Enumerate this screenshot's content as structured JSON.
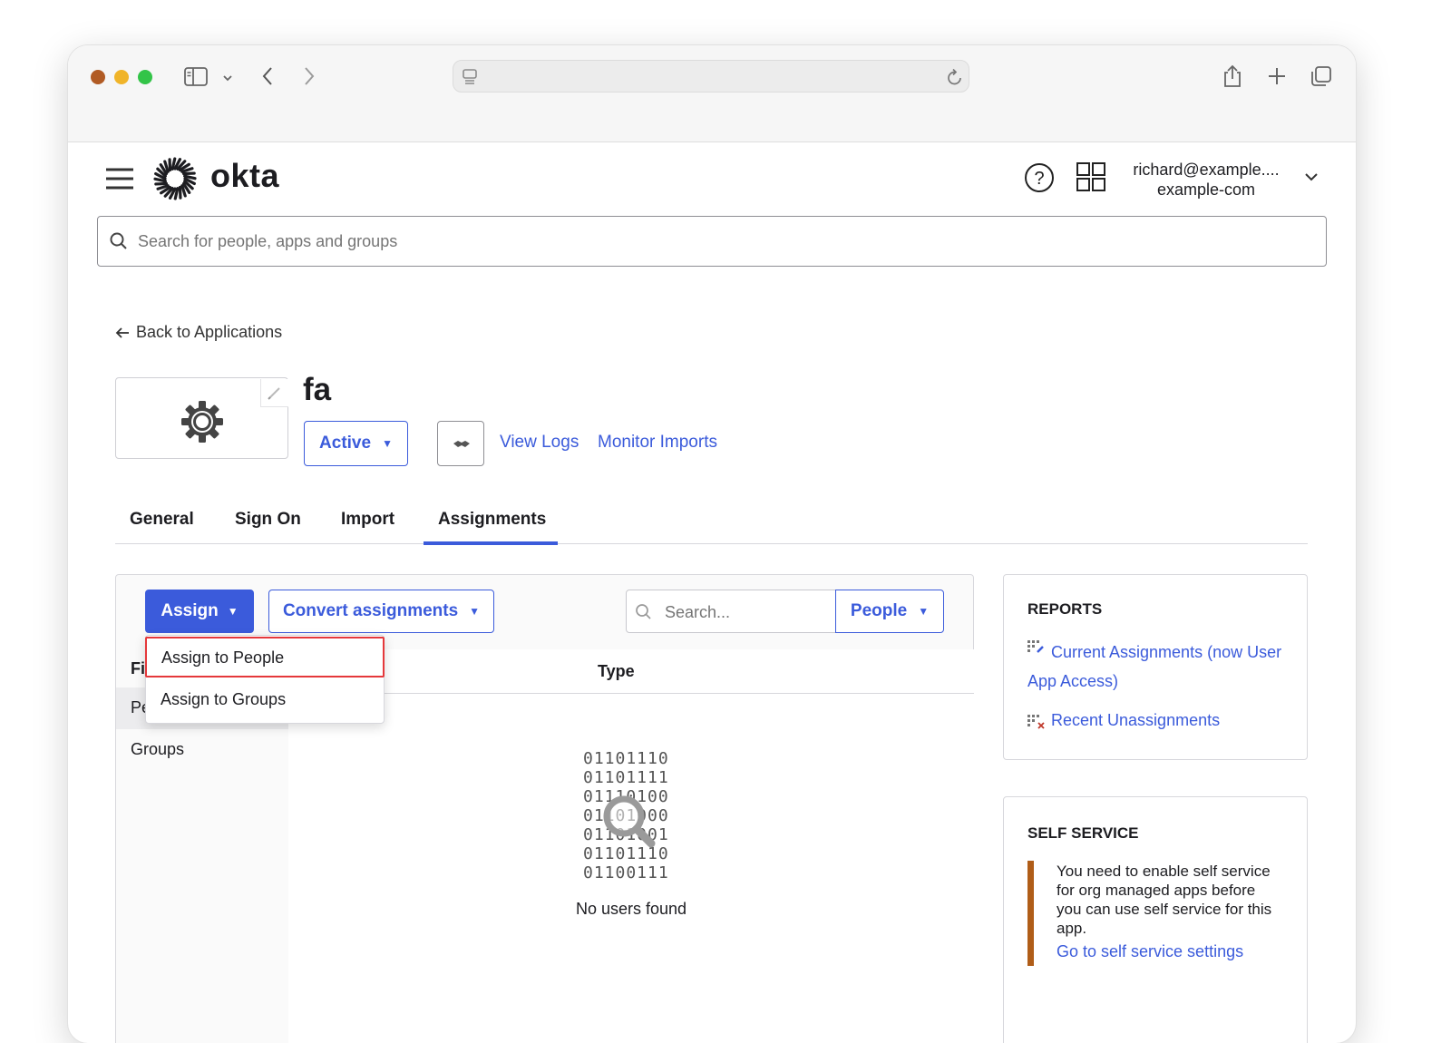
{
  "browser": {
    "colors": {
      "close": "#b15b24",
      "minimize": "#f0b429",
      "zoom": "#33c448"
    }
  },
  "header": {
    "brand": "okta",
    "search_placeholder": "Search for people, apps and groups",
    "user_email": "richard@example....",
    "user_org": "example-com"
  },
  "app": {
    "back_link": "Back to Applications",
    "name": "fa",
    "status_button": "Active",
    "view_logs": "View Logs",
    "monitor_imports": "Monitor Imports"
  },
  "tabs": [
    {
      "label": "General"
    },
    {
      "label": "Sign On"
    },
    {
      "label": "Import"
    },
    {
      "label": "Assignments",
      "active": true
    }
  ],
  "assignments": {
    "assign_button": "Assign",
    "convert_button": "Convert assignments",
    "search_placeholder": "Search...",
    "filter_button": "People",
    "dropdown": [
      "Assign to People",
      "Assign to Groups"
    ],
    "filters_heading_partial": "Fil",
    "filter_people_partial": "Pe",
    "filter_groups": "Groups",
    "column_type": "Type",
    "binary_lines": [
      "01101110",
      "01101111",
      "01110100",
      "01101000",
      "01101001",
      "01101110",
      "01100111"
    ],
    "empty_message": "No users found"
  },
  "reports": {
    "heading": "REPORTS",
    "link1": "Current Assignments (now User App Access)",
    "link2": "Recent Unassignments"
  },
  "self_service": {
    "heading": "SELF SERVICE",
    "message": "You need to enable self service for org managed apps before you can use self service for this app.",
    "link": "Go to self service settings"
  },
  "colors": {
    "accent": "#3b5bdb",
    "highlight": "#e5383b",
    "warning_bar": "#b05d18"
  }
}
